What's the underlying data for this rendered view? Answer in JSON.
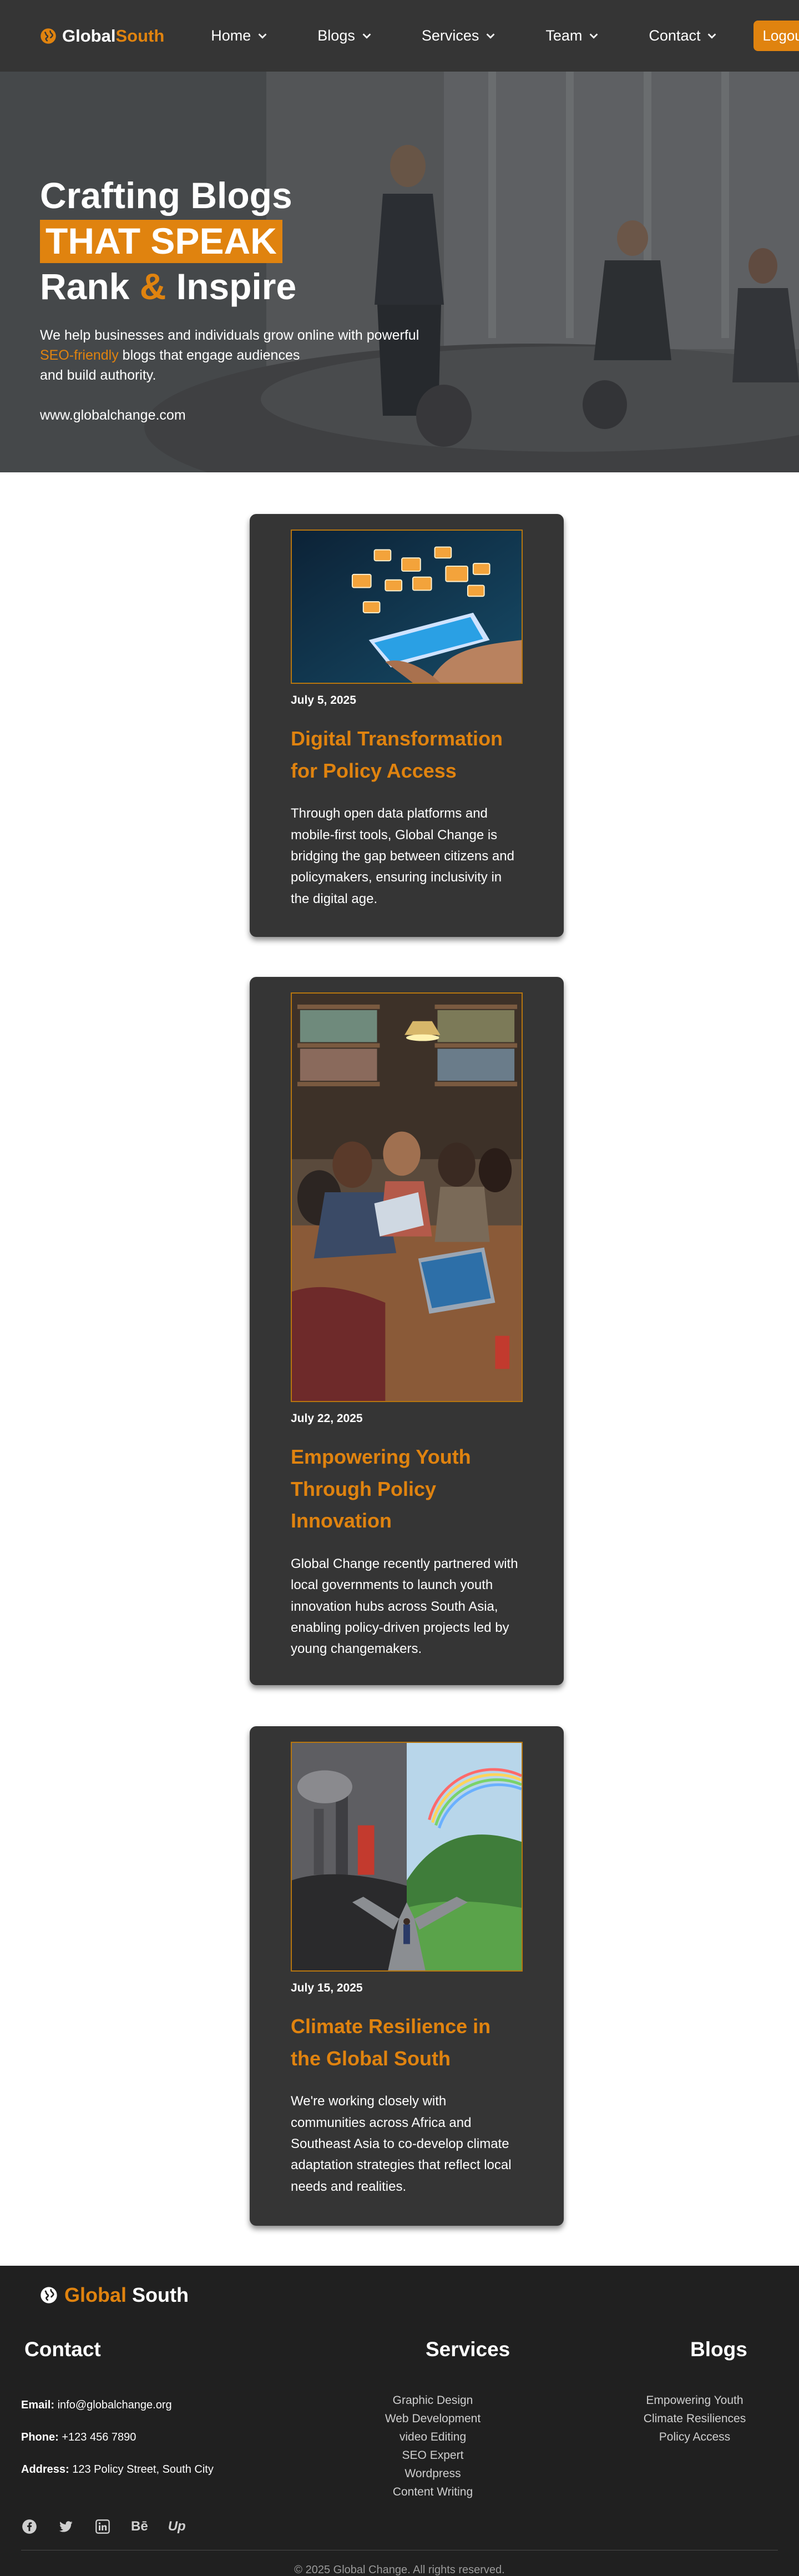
{
  "brand": {
    "part1": "Global",
    "part2": "South",
    "icon": "globe-icon"
  },
  "nav": {
    "items": [
      {
        "label": "Home"
      },
      {
        "label": "Blogs"
      },
      {
        "label": "Services"
      },
      {
        "label": "Team"
      },
      {
        "label": "Contact"
      }
    ],
    "logout_label": "Logout"
  },
  "hero": {
    "title_line1": "Crafting Blogs",
    "title_highlight": "THAT SPEAK",
    "title_line3a": "Rank ",
    "title_amp": "&",
    "title_line3b": " Inspire",
    "desc_part1": "We help businesses and individuals grow online with powerful",
    "desc_orange": "SEO-friendly",
    "desc_part2": " blogs that engage audiences",
    "desc_part3": "and build authority.",
    "url": "www.globalchange.com"
  },
  "posts": [
    {
      "date": "July 5, 2025",
      "title": "Digital Transformation for Policy Access",
      "text": "Through open data platforms and mobile-first tools, Global Change is bridging the gap between citizens and policymakers, ensuring inclusivity in the digital age."
    },
    {
      "date": "July 22, 2025",
      "title": "Empowering Youth Through Policy Innovation",
      "text": "Global Change recently partnered with local governments to launch youth innovation hubs across South Asia, enabling policy-driven projects led by young changemakers."
    },
    {
      "date": "July 15, 2025",
      "title": "Climate Resilience in the Global South",
      "text": "We're working closely with communities across Africa and Southeast Asia to co-develop climate adaptation strategies that reflect local needs and realities."
    }
  ],
  "footer": {
    "brand_part1": "Global",
    "brand_part2": " South",
    "contact_title": "Contact",
    "services_title": "Services",
    "blogs_title": "Blogs",
    "email_label": "Email:",
    "email": " info@globalchange.org",
    "phone_label": "Phone:",
    "phone": " +123 456 7890",
    "address_label": "Address:",
    "address": " 123 Policy Street, South City",
    "services": [
      "Graphic Design",
      "Web Development",
      "video Editing",
      "SEO Expert",
      "Wordpress",
      "Content Writing"
    ],
    "blogs": [
      "Empowering Youth",
      "Climate Resiliences",
      "Policy Access"
    ],
    "social_icons": [
      "facebook-icon",
      "twitter-icon",
      "linkedin-icon",
      "behance-icon",
      "upwork-icon"
    ],
    "behance_label": "Bē",
    "upwork_label": "Up",
    "copyright": "© 2025 Global Change. All rights reserved."
  },
  "colors": {
    "accent": "#e0830f",
    "nav_bg": "#353535",
    "card_bg": "#353535",
    "footer_bg": "#202020"
  }
}
